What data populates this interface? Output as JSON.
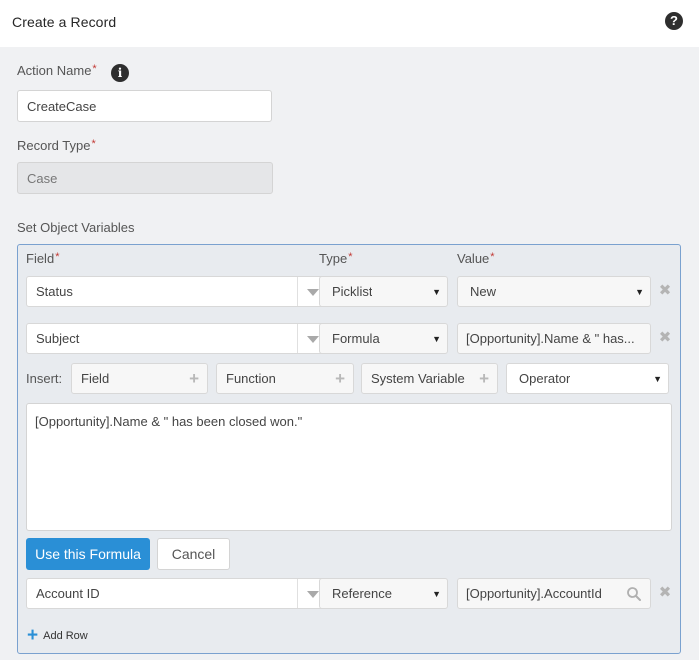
{
  "header": {
    "title": "Create a Record",
    "help_icon": "?"
  },
  "form": {
    "action_name": {
      "label": "Action Name",
      "required_mark": "*",
      "info_icon": "i",
      "value": "CreateCase"
    },
    "record_type": {
      "label": "Record Type",
      "required_mark": "*",
      "value": "Case"
    },
    "section_label": "Set Object Variables"
  },
  "variables": {
    "columns": [
      {
        "label": "Field",
        "required_mark": "*"
      },
      {
        "label": "Type",
        "required_mark": "*"
      },
      {
        "label": "Value",
        "required_mark": "*"
      }
    ],
    "rows": [
      {
        "field": "Status",
        "type": "Picklist",
        "value": "New",
        "value_kind": "select"
      },
      {
        "field": "Subject",
        "type": "Formula",
        "value": "[Opportunity].Name & \" has...",
        "value_kind": "select-none"
      },
      {
        "field": "Account ID",
        "type": "Reference",
        "value": "[Opportunity].AccountId",
        "value_kind": "lookup"
      }
    ],
    "formula_editor": {
      "insert_label": "Insert:",
      "insert_buttons": [
        "Field",
        "Function",
        "System Variable"
      ],
      "operator_label": "Operator",
      "text": "[Opportunity].Name & \" has been closed won.\"",
      "use_button": "Use this Formula",
      "cancel_button": "Cancel"
    },
    "add_row_label": "Add Row",
    "arrow_glyph": "▼",
    "remove_glyph": "✖",
    "plus_glyph": "+"
  },
  "colors": {
    "primary": "#2a8fd6",
    "panel_border": "#7aa1cf",
    "required": "#c23934"
  }
}
